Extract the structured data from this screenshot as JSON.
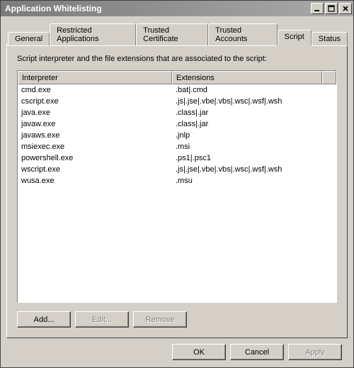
{
  "window": {
    "title": "Application Whitelisting"
  },
  "tabs": {
    "general": "General",
    "restricted": "Restricted Applications",
    "trustedcert": "Trusted Certificate",
    "trustedaccts": "Trusted Accounts",
    "script": "Script",
    "status": "Status"
  },
  "script_tab": {
    "description": "Script interpreter and the file extensions that are associated to the script:",
    "columns": {
      "interpreter": "Interpreter",
      "extensions": "Extensions"
    },
    "rows": [
      {
        "interpreter": "cmd.exe",
        "extensions": ".bat|.cmd"
      },
      {
        "interpreter": "cscript.exe",
        "extensions": ".js|.jse|.vbe|.vbs|.wsc|.wsf|.wsh"
      },
      {
        "interpreter": "java.exe",
        "extensions": ".class|.jar"
      },
      {
        "interpreter": "javaw.exe",
        "extensions": ".class|.jar"
      },
      {
        "interpreter": "javaws.exe",
        "extensions": ".jnlp"
      },
      {
        "interpreter": "msiexec.exe",
        "extensions": ".msi"
      },
      {
        "interpreter": "powershell.exe",
        "extensions": ".ps1|.psc1"
      },
      {
        "interpreter": "wscript.exe",
        "extensions": ".js|.jse|.vbe|.vbs|.wsc|.wsf|.wsh"
      },
      {
        "interpreter": "wusa.exe",
        "extensions": ".msu"
      }
    ],
    "buttons": {
      "add": "Add...",
      "edit": "Edit...",
      "remove": "Remove"
    }
  },
  "dialog_buttons": {
    "ok": "OK",
    "cancel": "Cancel",
    "apply": "Apply"
  }
}
